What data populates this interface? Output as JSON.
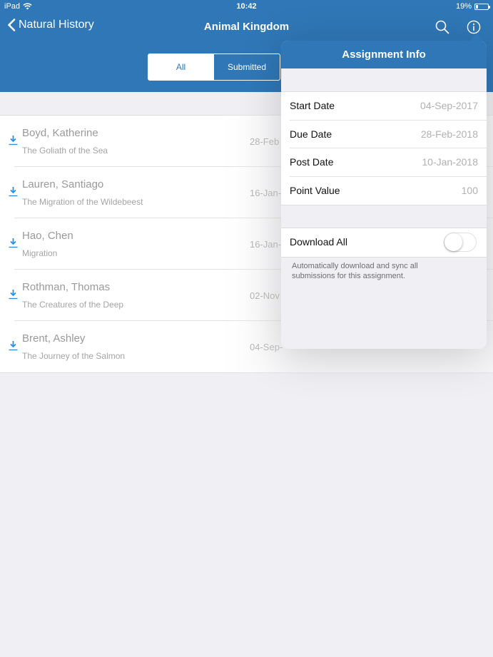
{
  "status_bar": {
    "device": "iPad",
    "time": "10:42",
    "battery": "19%",
    "battery_level": 0.19
  },
  "nav": {
    "back_label": "Natural History",
    "title": "Animal Kingdom"
  },
  "tabs": [
    {
      "label": "All",
      "active": true
    },
    {
      "label": "Submitted",
      "active": false
    }
  ],
  "submissions": [
    {
      "name": "Boyd, Katherine",
      "title": "The Goliath of the Sea",
      "date": "28-Feb"
    },
    {
      "name": "Lauren, Santiago",
      "title": "The Migration of the Wildebeest",
      "date": "16-Jan-"
    },
    {
      "name": "Hao, Chen",
      "title": "Migration",
      "date": "16-Jan-"
    },
    {
      "name": "Rothman, Thomas",
      "title": "The Creatures of the Deep",
      "date": "02-Nov"
    },
    {
      "name": "Brent, Ashley",
      "title": "The Journey of the Salmon",
      "date": "04-Sep-"
    }
  ],
  "assignment_info": {
    "title": "Assignment Info",
    "fields": [
      {
        "label": "Start Date",
        "value": "04-Sep-2017"
      },
      {
        "label": "Due Date",
        "value": "28-Feb-2018"
      },
      {
        "label": "Post Date",
        "value": "10-Jan-2018"
      },
      {
        "label": "Point Value",
        "value": "100"
      }
    ],
    "download_all": {
      "label": "Download All",
      "enabled": false
    },
    "help_text": "Automatically download and sync all submissions for this assignment."
  },
  "colors": {
    "brand": "#2f77b6",
    "download_icon": "#2f8fdc"
  },
  "icons": {
    "back": "chevron-left-icon",
    "search": "search-icon",
    "info": "info-icon",
    "download": "download-icon"
  }
}
